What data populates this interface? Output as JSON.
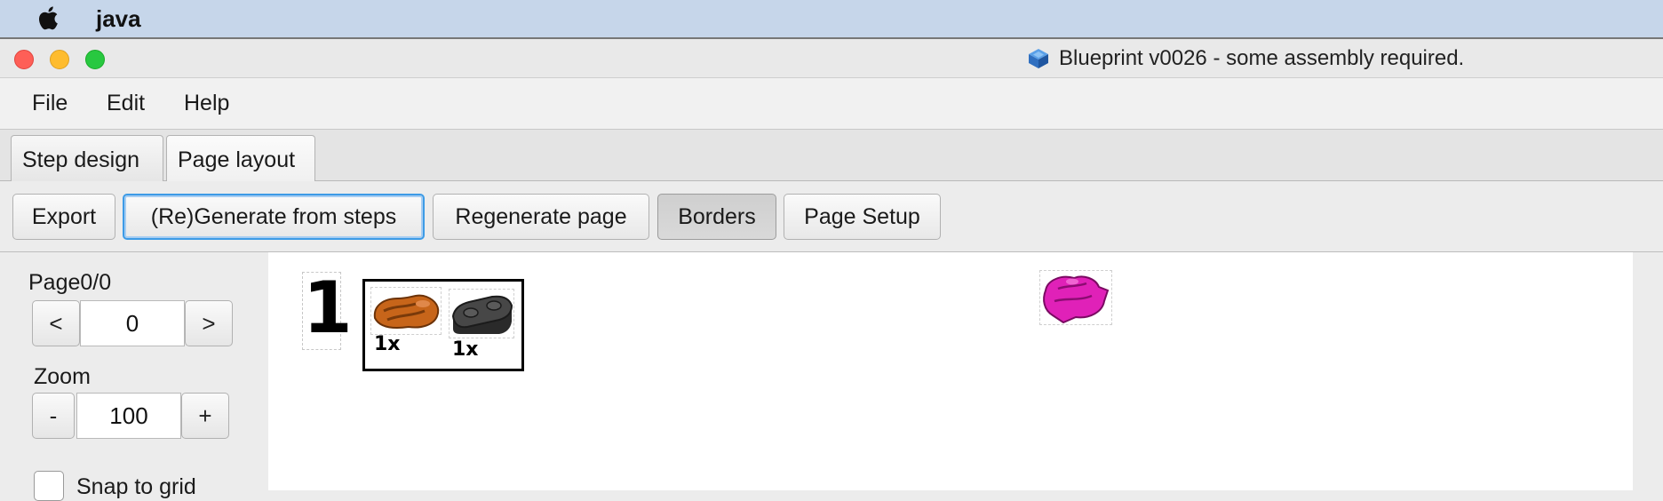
{
  "os_menubar": {
    "app_name": "java"
  },
  "window": {
    "title": "Blueprint v0026 - some assembly required."
  },
  "menu": {
    "items": [
      "File",
      "Edit",
      "Help"
    ]
  },
  "tabs": [
    {
      "label": "Step design",
      "active": false
    },
    {
      "label": "Page layout",
      "active": true
    }
  ],
  "toolbar": {
    "export_label": "Export",
    "generate_label": "(Re)Generate from steps",
    "regenerate_label": "Regenerate page",
    "borders_label": "Borders",
    "page_setup_label": "Page Setup"
  },
  "side": {
    "page_label": "Page0/0",
    "page_prev": "<",
    "page_value": "0",
    "page_next": ">",
    "zoom_label": "Zoom",
    "zoom_minus": "-",
    "zoom_value": "100",
    "zoom_plus": "+",
    "snap_label": "Snap to grid"
  },
  "canvas": {
    "step_number": "1",
    "parts": [
      {
        "qty": "1x",
        "color": "#c7651a",
        "icon": "orange-curved-part-icon"
      },
      {
        "qty": "1x",
        "color": "#3c3c3c",
        "icon": "dark-gray-plate-icon"
      }
    ],
    "floating_part_color": "#e021b8"
  },
  "colors": {
    "focus_ring": "#3d9be6",
    "menubar_bg": "#c6d6ea"
  }
}
